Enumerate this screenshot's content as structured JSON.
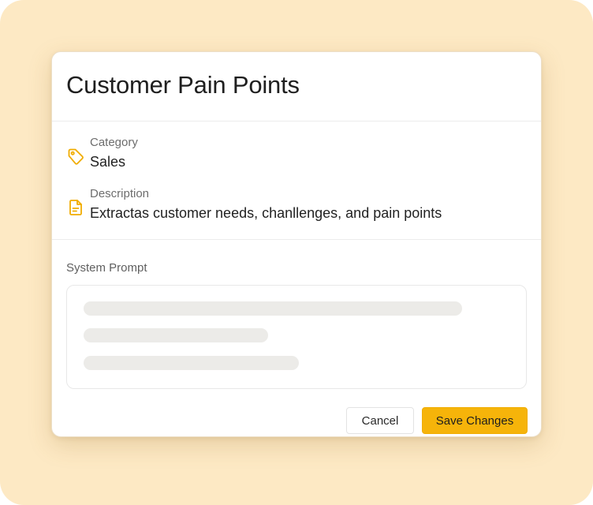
{
  "dialog": {
    "title": "Customer Pain Points",
    "category": {
      "label": "Category",
      "value": "Sales",
      "icon": "tag-icon"
    },
    "description": {
      "label": "Description",
      "value": "Extractas customer needs, chanllenges, and pain points",
      "icon": "document-icon"
    },
    "system_prompt": {
      "label": "System Prompt",
      "loading": true
    },
    "actions": {
      "cancel_label": "Cancel",
      "save_label": "Save Changes"
    }
  },
  "colors": {
    "backdrop": "#fde9c4",
    "accent": "#f6b40a",
    "icon": "#f0ac00"
  }
}
